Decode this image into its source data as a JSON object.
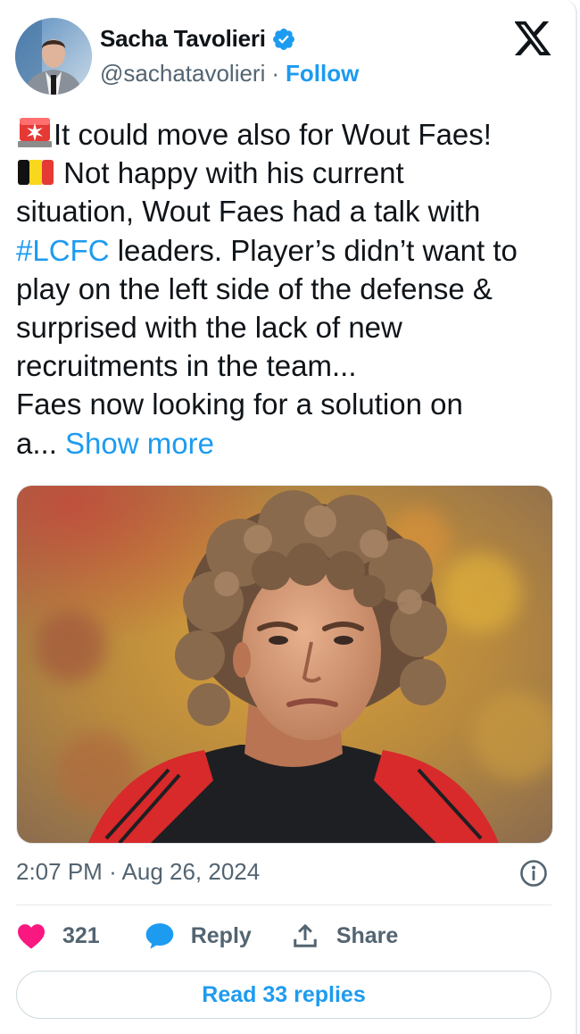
{
  "author": {
    "display_name": "Sacha Tavolieri",
    "handle": "@sachatavolieri",
    "separator": "·",
    "follow_label": "Follow"
  },
  "tweet": {
    "lines": [
      "It could move also for Wout Faes!",
      " Not happy with his current",
      "situation, Wout Faes had a talk with",
      " leaders. Player’s didn’t want to",
      "play on the left side of the defense &",
      "surprised with the lack of new",
      "recruitments in the team...",
      "Faes now looking for a solution on",
      "a... "
    ],
    "hashtag": "#LCFC",
    "show_more_label": "Show more"
  },
  "meta": {
    "time": "2:07 PM",
    "separator": "·",
    "date": "Aug 26, 2024"
  },
  "actions": {
    "like_count": "321",
    "reply_label": "Reply",
    "share_label": "Share"
  },
  "read_replies_label": "Read 33 replies",
  "colors": {
    "accent": "#1d9bf0",
    "like": "#f91880",
    "text": "#0f1419",
    "muted": "#536471"
  }
}
